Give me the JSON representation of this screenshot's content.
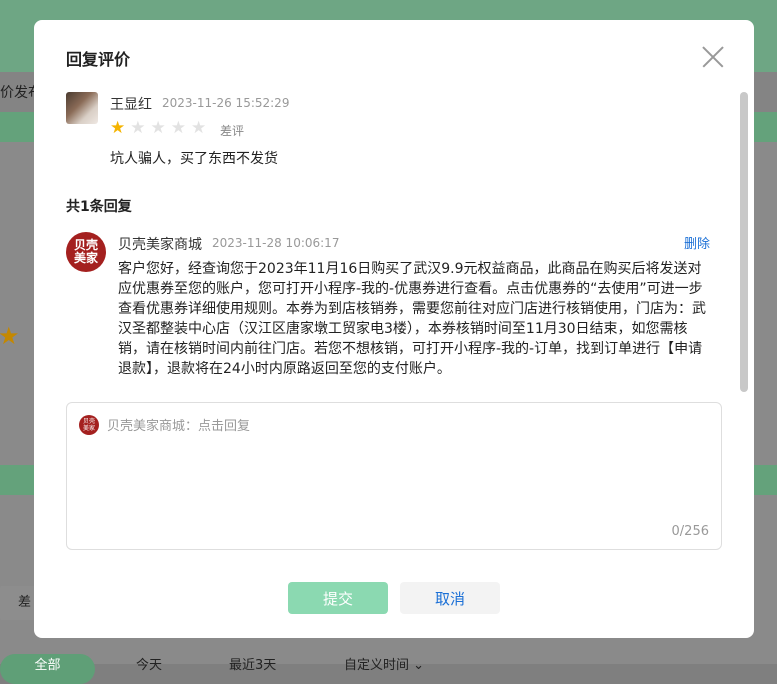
{
  "background": {
    "partial_text_1": "价发布",
    "partial_text_2": "差",
    "tabs": [
      "全部",
      "今天",
      "最近3天",
      "自定义时间"
    ],
    "tab_chevron": "chevron-down-icon"
  },
  "modal": {
    "title": "回复评价",
    "close_icon": "close-icon"
  },
  "review": {
    "reviewer_name": "王显红",
    "time": "2023-11-26 15:52:29",
    "rating": 1,
    "rating_max": 5,
    "rating_label": "差评",
    "content": "坑人骗人，买了东西不发货"
  },
  "replies": {
    "count_label": "共1条回复",
    "items": [
      {
        "shop_name": "贝壳美家商城",
        "avatar_text": "贝壳美家",
        "time": "2023-11-28 10:06:17",
        "delete_label": "删除",
        "content": "客户您好，经查询您于2023年11月16日购买了武汉9.9元权益商品，此商品在购买后将发送对应优惠券至您的账户，您可打开小程序-我的-优惠券进行查看。点击优惠券的“去使用”可进一步查看优惠券详细使用规则。本券为到店核销券，需要您前往对应门店进行核销使用，门店为：武汉圣都整装中心店（汉江区唐家墩工贸家电3楼），本券核销时间至11月30日结束，如您需核销，请在核销时间内前往门店。若您不想核销，可打开小程序-我的-订单，找到订单进行【申请退款】，退款将在24小时内原路返回至您的支付账户。"
      }
    ]
  },
  "reply_form": {
    "placeholder": "贝壳美家商城：点击回复",
    "value": "",
    "char_count": "0/256",
    "submit_label": "提交",
    "cancel_label": "取消"
  },
  "colors": {
    "accent_green": "#8bd9b1",
    "link_blue": "#1a6fd6",
    "star": "#f5b400",
    "brand_red": "#a4201f"
  }
}
